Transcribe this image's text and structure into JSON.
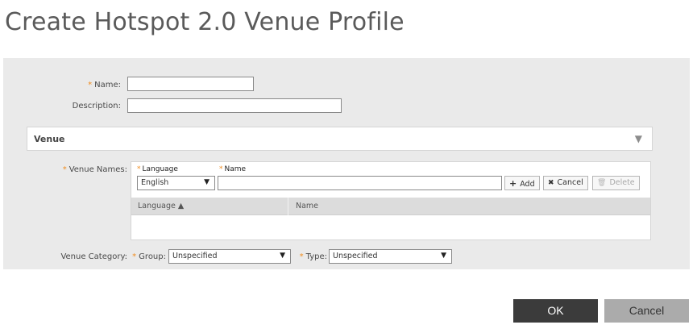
{
  "page": {
    "title": "Create Hotspot 2.0 Venue Profile"
  },
  "form": {
    "required_marker": "*",
    "name_label": "Name:",
    "name_value": "",
    "description_label": "Description:",
    "description_value": ""
  },
  "venue": {
    "section_title": "Venue",
    "toggle_glyph": "▼",
    "venue_names_label": "Venue Names:",
    "language_header": "Language",
    "name_header": "Name",
    "language_selected": "English",
    "name_value": "",
    "add_label": "Add",
    "cancel_label": "Cancel",
    "delete_label": "Delete",
    "table_columns": [
      "Language ▲",
      "Name"
    ],
    "table_rows": [],
    "category_label": "Venue Category:",
    "group_label": "Group:",
    "group_selected": "Unspecified",
    "type_label": "Type:",
    "type_selected": "Unspecified"
  },
  "icons": {
    "add": "+",
    "cancel": "✖",
    "delete": "🗑",
    "dropdown": "▼"
  },
  "footer": {
    "ok_label": "OK",
    "cancel_label": "Cancel"
  },
  "colors": {
    "required": "#f08c1e",
    "ok_button": "#3b3b3b",
    "cancel_button": "#ababab",
    "panel": "#eaeaea"
  }
}
